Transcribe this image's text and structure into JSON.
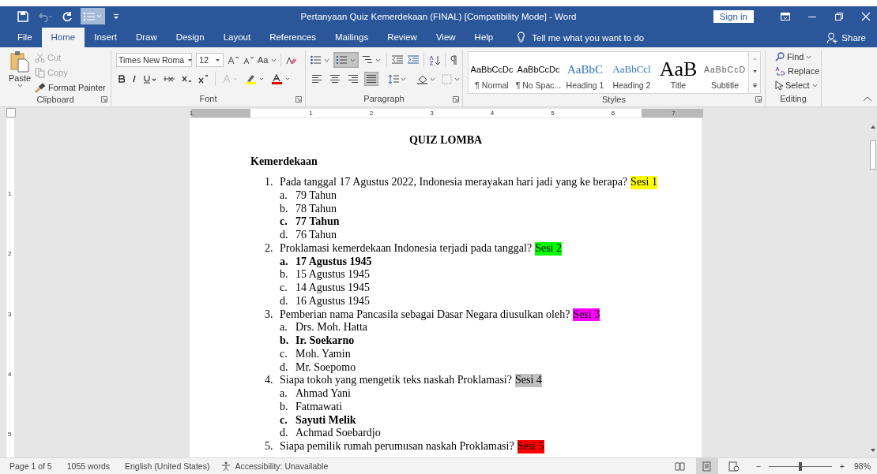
{
  "window": {
    "title": "Pertanyaan Quiz Kemerdekaan (FINAL) [Compatibility Mode]  -  Word",
    "sign_in": "Sign in"
  },
  "ribbon_tabs": [
    {
      "label": "File",
      "selected": false
    },
    {
      "label": "Home",
      "selected": true
    },
    {
      "label": "Insert",
      "selected": false
    },
    {
      "label": "Draw",
      "selected": false
    },
    {
      "label": "Design",
      "selected": false
    },
    {
      "label": "Layout",
      "selected": false
    },
    {
      "label": "References",
      "selected": false
    },
    {
      "label": "Mailings",
      "selected": false
    },
    {
      "label": "Review",
      "selected": false
    },
    {
      "label": "View",
      "selected": false
    },
    {
      "label": "Help",
      "selected": false
    }
  ],
  "tell_me": {
    "placeholder": "Tell me what you want to do"
  },
  "share": "Share",
  "clipboard": {
    "label": "Clipboard",
    "paste": "Paste",
    "cut": "Cut",
    "copy": "Copy",
    "format_painter": "Format Painter",
    "cut_disabled": true,
    "copy_disabled": true
  },
  "font": {
    "label": "Font",
    "name": "Times New Roma",
    "size": "12",
    "change_case": "Aa"
  },
  "paragraph": {
    "label": "Paragraph",
    "alignment": [
      {
        "kind": "left",
        "selected": false
      },
      {
        "kind": "center",
        "selected": false
      },
      {
        "kind": "right",
        "selected": false
      },
      {
        "kind": "justify",
        "selected": true
      }
    ]
  },
  "styles": {
    "label": "Styles",
    "items": [
      {
        "kind": "normal",
        "preview": "AaBbCcDc",
        "name": "¶ Normal"
      },
      {
        "kind": "normal",
        "preview": "AaBbCcDc",
        "name": "¶ No Spac..."
      },
      {
        "kind": "heading1",
        "preview": "AaBbC",
        "name": "Heading 1"
      },
      {
        "kind": "heading2",
        "preview": "AaBbCcl",
        "name": "Heading 2"
      },
      {
        "kind": "title",
        "preview": "AaB",
        "name": "Title"
      },
      {
        "kind": "subtitle",
        "preview": "AaBbCcD",
        "name": "Subtitle"
      }
    ]
  },
  "editing": {
    "label": "Editing",
    "find": "Find",
    "replace": "Replace",
    "select": "Select"
  },
  "ruler": {
    "horizontal": [
      "1",
      "1",
      "2",
      "3",
      "4",
      "5",
      "6",
      "7"
    ],
    "vertical": [
      "1",
      "2",
      "3",
      "4",
      "5"
    ]
  },
  "document": {
    "title": "QUIZ LOMBA",
    "heading": "Kemerdekaan",
    "questions": [
      {
        "number": "1.",
        "text": "Pada tanggal 17 Agustus 2022, Indonesia merayakan hari jadi yang ke berapa?",
        "session": "Sesi 1",
        "color": "#ffff00",
        "options": [
          {
            "letter": "a.",
            "text": "79 Tahun",
            "correct": false
          },
          {
            "letter": "b.",
            "text": "78 Tahun",
            "correct": false
          },
          {
            "letter": "c.",
            "text": "77 Tahun",
            "correct": true
          },
          {
            "letter": "d.",
            "text": "76 Tahun",
            "correct": false
          }
        ]
      },
      {
        "number": "2.",
        "text": "Proklamasi kemerdekaan Indonesia terjadi pada tanggal?",
        "session": "Sesi 2",
        "color": "#00ff00",
        "options": [
          {
            "letter": "a.",
            "text": "17 Agustus 1945",
            "correct": true
          },
          {
            "letter": "b.",
            "text": "15 Agustus 1945",
            "correct": false
          },
          {
            "letter": "c.",
            "text": "14 Agustus 1945",
            "correct": false
          },
          {
            "letter": "d.",
            "text": "16 Agustus 1945",
            "correct": false
          }
        ]
      },
      {
        "number": "3.",
        "text": "Pemberian nama Pancasila sebagai Dasar Negara diusulkan oleh?",
        "session": "Sesi 3",
        "color": "#ff00ff",
        "options": [
          {
            "letter": "a.",
            "text": "Drs. Moh. Hatta",
            "correct": false
          },
          {
            "letter": "b.",
            "text": "Ir. Soekarno",
            "correct": true
          },
          {
            "letter": "c.",
            "text": "Moh. Yamin",
            "correct": false
          },
          {
            "letter": "d.",
            "text": "Mr. Soepomo",
            "correct": false
          }
        ]
      },
      {
        "number": "4.",
        "text": "Siapa tokoh yang mengetik teks naskah Proklamasi?",
        "session": "Sesi 4",
        "color": "#c0c0c0",
        "options": [
          {
            "letter": "a.",
            "text": "Ahmad Yani",
            "correct": false
          },
          {
            "letter": "b.",
            "text": "Fatmawati",
            "correct": false
          },
          {
            "letter": "c.",
            "text": "Sayuti Melik",
            "correct": true
          },
          {
            "letter": "d.",
            "text": "Achmad Soebardjo",
            "correct": false
          }
        ]
      },
      {
        "number": "5.",
        "text": "Siapa pemilik rumah perumusan naskah Proklamasi?",
        "session": "Sesi 5",
        "color": "#ff0000"
      }
    ]
  },
  "status_bar": {
    "page": "Page 1 of 5",
    "words": "1055 words",
    "language": "English (United States)",
    "accessibility": "Accessibility: Unavailable",
    "views": [
      {
        "kind": "read",
        "selected": false
      },
      {
        "kind": "print",
        "selected": true
      },
      {
        "kind": "web",
        "selected": false
      }
    ],
    "zoom": {
      "level": 0.5,
      "minus": "−",
      "plus": "+",
      "percent": "98%"
    }
  }
}
